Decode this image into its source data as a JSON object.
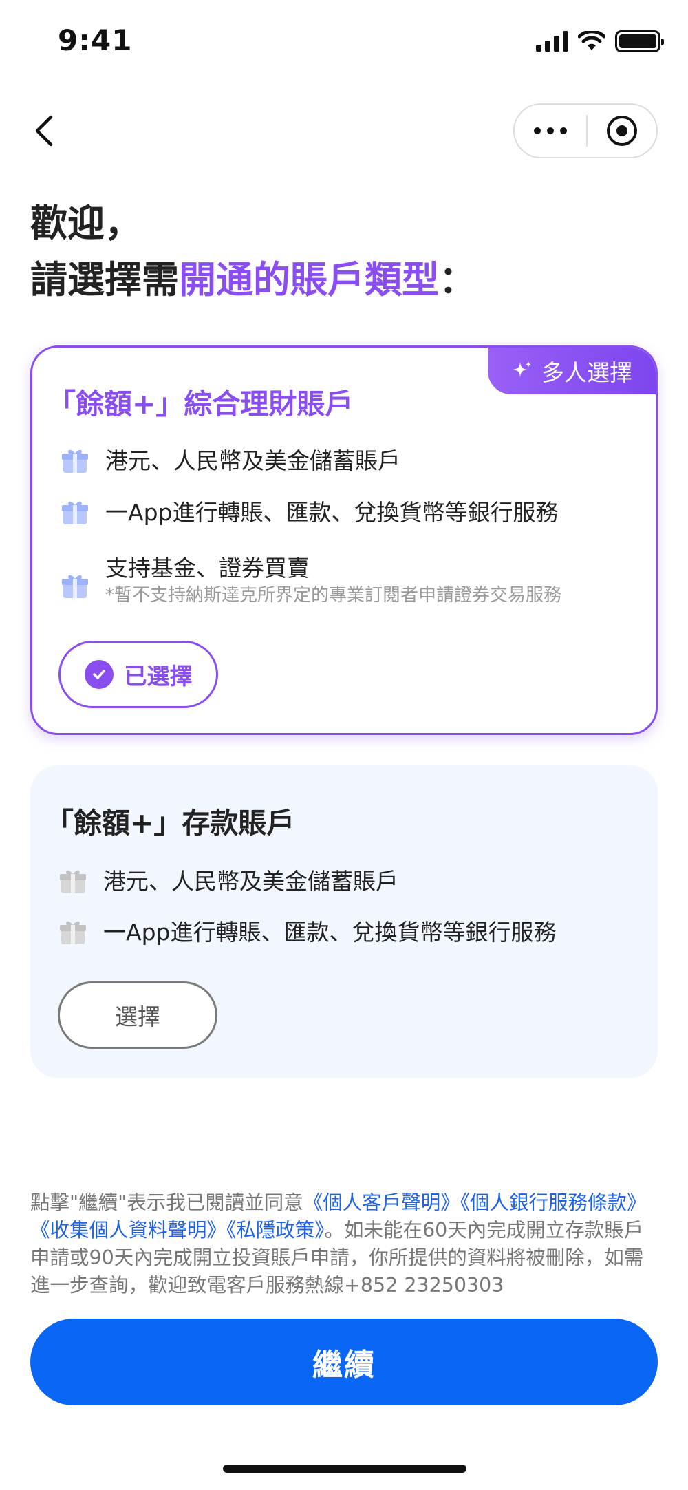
{
  "status_bar": {
    "time": "9:41"
  },
  "heading": {
    "line1": "歡迎，",
    "line2_prefix": "請選擇需",
    "line2_accent": "開通的賬戶類型",
    "line2_suffix": "："
  },
  "cards": {
    "investment": {
      "tag": "多人選擇",
      "title": "「餘額+」綜合理財賬戶",
      "features": [
        {
          "text": "港元、人民幣及美金儲蓄賬戶"
        },
        {
          "text": "一App進行轉賬、匯款、兌換貨幣等銀行服務"
        },
        {
          "text": "支持基金、證券買賣",
          "note": "*暫不支持納斯達克所界定的專業訂閱者申請證券交易服務"
        }
      ],
      "button_label": "已選擇",
      "selected": true
    },
    "deposit": {
      "title": "「餘額+」存款賬戶",
      "features": [
        {
          "text": "港元、人民幣及美金儲蓄賬戶"
        },
        {
          "text": "一App進行轉賬、匯款、兌換貨幣等銀行服務"
        }
      ],
      "button_label": "選擇",
      "selected": false
    }
  },
  "disclaimer": {
    "prefix": "點擊\"繼續\"表示我已閱讀並同意",
    "link1": "《個人客戶聲明》",
    "link2": "《個人銀行服務條款》",
    "link3": "《收集個人資料聲明》",
    "link4": "《私隱政策》",
    "suffix": "。如未能在60天內完成開立存款賬戶申請或90天內完成開立投資賬戶申請，你所提供的資料將被刪除，如需進一步查詢，歡迎致電客戶服務熱線+852 23250303"
  },
  "continue_label": "繼續",
  "colors": {
    "accent_purple": "#8a4df0",
    "primary_blue": "#0a66f5",
    "link_blue": "#1e62e6",
    "card_bg": "#f1f6ff"
  },
  "icons": {
    "back": "chevron-left-icon",
    "more": "more-dots-icon",
    "close": "target-circle-icon",
    "tag": "sparkle-icon",
    "feature": "gift-icon",
    "check": "check-icon"
  }
}
